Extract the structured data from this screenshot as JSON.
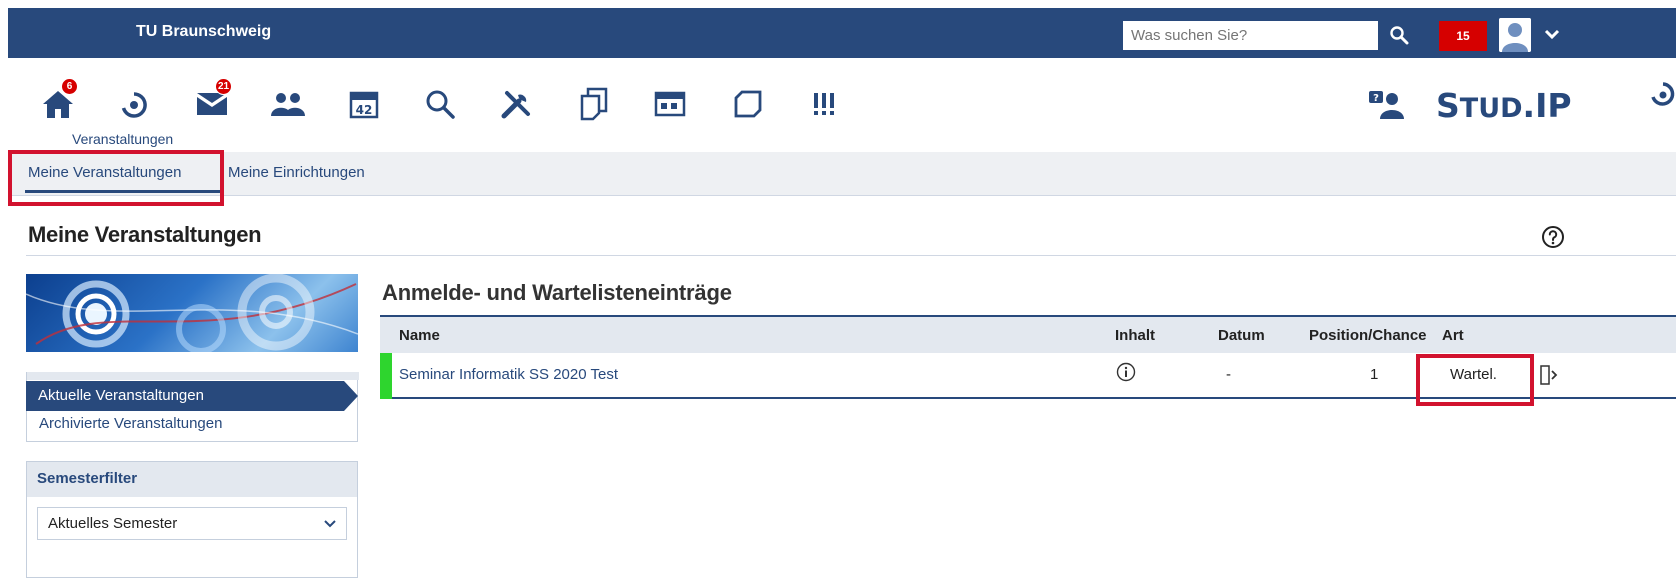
{
  "topbar": {
    "brand": "TU Braunschweig",
    "search_placeholder": "Was suchen Sie?",
    "notification_count": "15"
  },
  "nav": {
    "home_badge": "6",
    "messages_badge": "21",
    "active_label": "Veranstaltungen",
    "calendar_text": "42"
  },
  "logo": {
    "text_a": "S",
    "text_b": "TUD",
    "text_c": ".IP"
  },
  "tabs": [
    {
      "label": "Meine Veranstaltungen"
    },
    {
      "label": "Meine Einrichtungen"
    }
  ],
  "page": {
    "title": "Meine Veranstaltungen"
  },
  "sidebar": {
    "views": [
      {
        "label": "Aktuelle Veranstaltungen"
      },
      {
        "label": "Archivierte Veranstaltungen"
      }
    ],
    "filter_title": "Semesterfilter",
    "semester_selected": "Aktuelles Semester"
  },
  "main": {
    "section_title": "Anmelde- und Wartelisteneinträge",
    "columns": [
      "Name",
      "Inhalt",
      "Datum",
      "Position/Chance",
      "Art"
    ],
    "rows": [
      {
        "name": "Seminar Informatik SS 2020 Test",
        "datum": "-",
        "position": "1",
        "art": "Wartel."
      }
    ]
  },
  "colors": {
    "primary": "#28497c",
    "highlight": "#d2122e",
    "badge": "#d60000",
    "row_marker": "#2ed52e"
  }
}
